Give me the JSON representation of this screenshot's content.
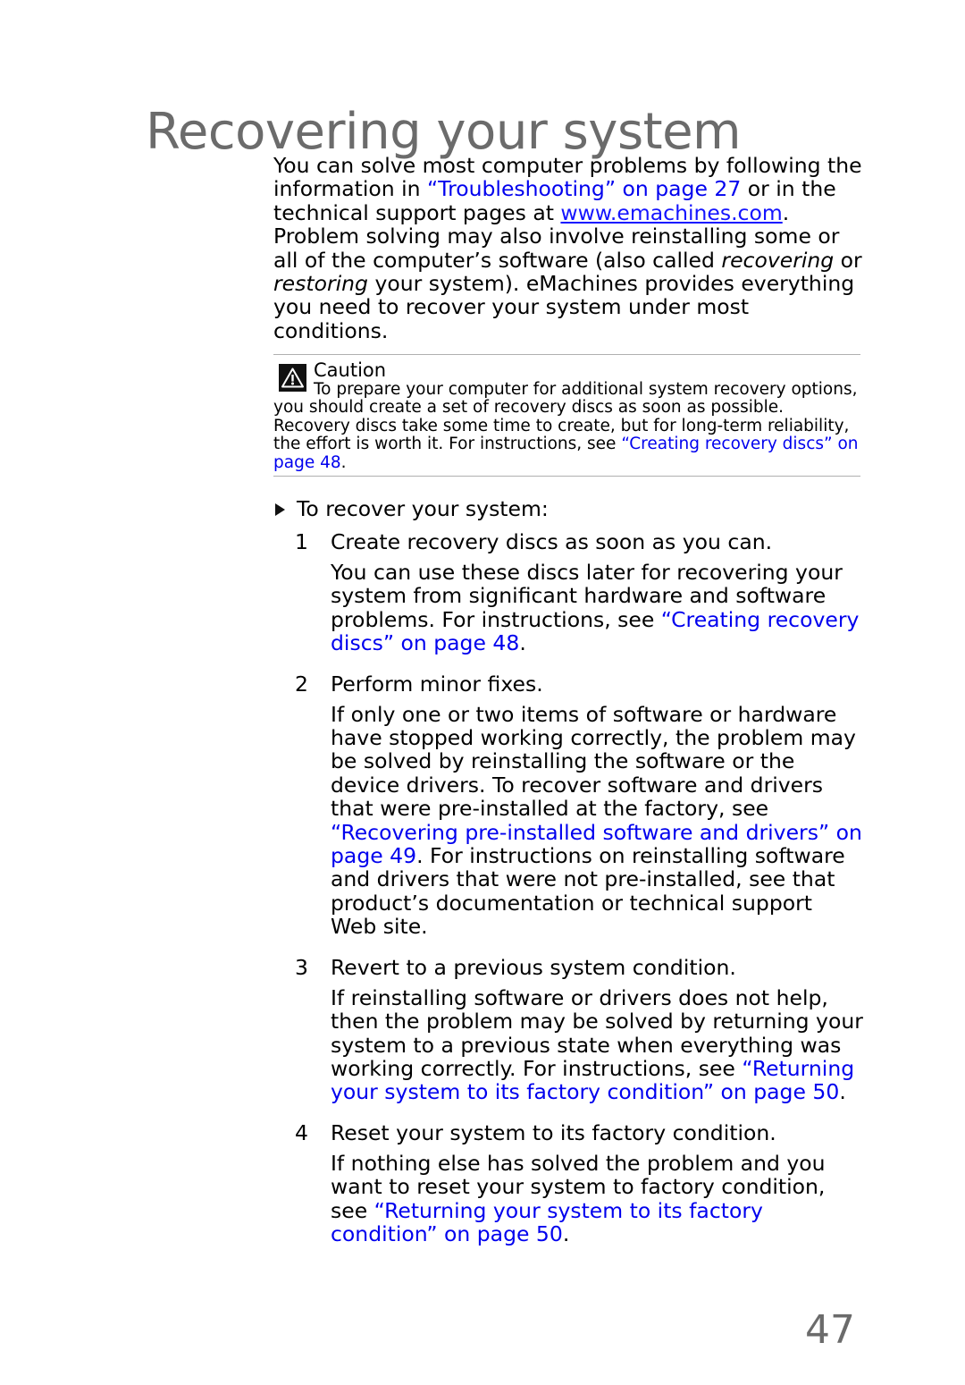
{
  "document": {
    "title": "Recovering your system",
    "page_number": "47"
  },
  "colors": {
    "title_gray": "#6b6b6b",
    "link_blue": "#1414ff",
    "body_black": "#000000",
    "rule_gray": "#b0b0b0"
  },
  "intro": {
    "part1": "You can solve most computer problems by following the information in ",
    "link1": "“Troubleshooting” on page 27",
    "part2": " or in the technical support pages at ",
    "link2": "www.emachines.com",
    "part3": ". Problem solving may also involve reinstalling some or all of the computer’s software (also called ",
    "italic1": "recovering",
    "part4": " or ",
    "italic2": "restoring",
    "part5": " your system). eMachines provides everything you need to recover your system under most conditions."
  },
  "caution": {
    "icon": "warning-triangle-icon",
    "heading": "Caution",
    "body_part1": "To prepare your computer for additional system recovery options, you should create a set of recovery discs as soon as possible. Recovery discs take some time to create, but for long-term reliability, the effort is worth it. For instructions, see ",
    "body_link": "“Creating recovery discs” on page 48",
    "body_part2": "."
  },
  "procedure": {
    "heading": "To recover your system:",
    "bullet_icon": "triangle-right-bullet-icon",
    "steps": [
      {
        "number": "1",
        "title": "Create recovery discs as soon as you can.",
        "body_part1": "You can use these discs later for recovering your system from significant hardware and software problems. For instructions, see ",
        "body_link": "“Creating recovery discs” on page 48",
        "body_part2": "."
      },
      {
        "number": "2",
        "title": "Perform minor fixes.",
        "body_part1": "If only one or two items of software or hardware have stopped working correctly, the problem may be solved by reinstalling the software or the device drivers. To recover software and drivers that were pre-installed at the factory, see ",
        "body_link": "“Recovering pre-installed software and drivers” on page 49",
        "body_part2": ". For instructions on reinstalling software and drivers that were not pre-installed, see that product’s documentation or technical support Web site."
      },
      {
        "number": "3",
        "title": "Revert to a previous system condition.",
        "body_part1": "If reinstalling software or drivers does not help, then the problem may be solved by returning your system to a previous state when everything was working correctly. For instructions, see ",
        "body_link": "“Returning your system to its factory condition” on page 50",
        "body_part2": "."
      },
      {
        "number": "4",
        "title": "Reset your system to its factory condition.",
        "body_part1": "If nothing else has solved the problem and you want to reset your system to factory condition, see ",
        "body_link": "“Returning your system to its factory condition” on page 50",
        "body_part2": "."
      }
    ]
  }
}
